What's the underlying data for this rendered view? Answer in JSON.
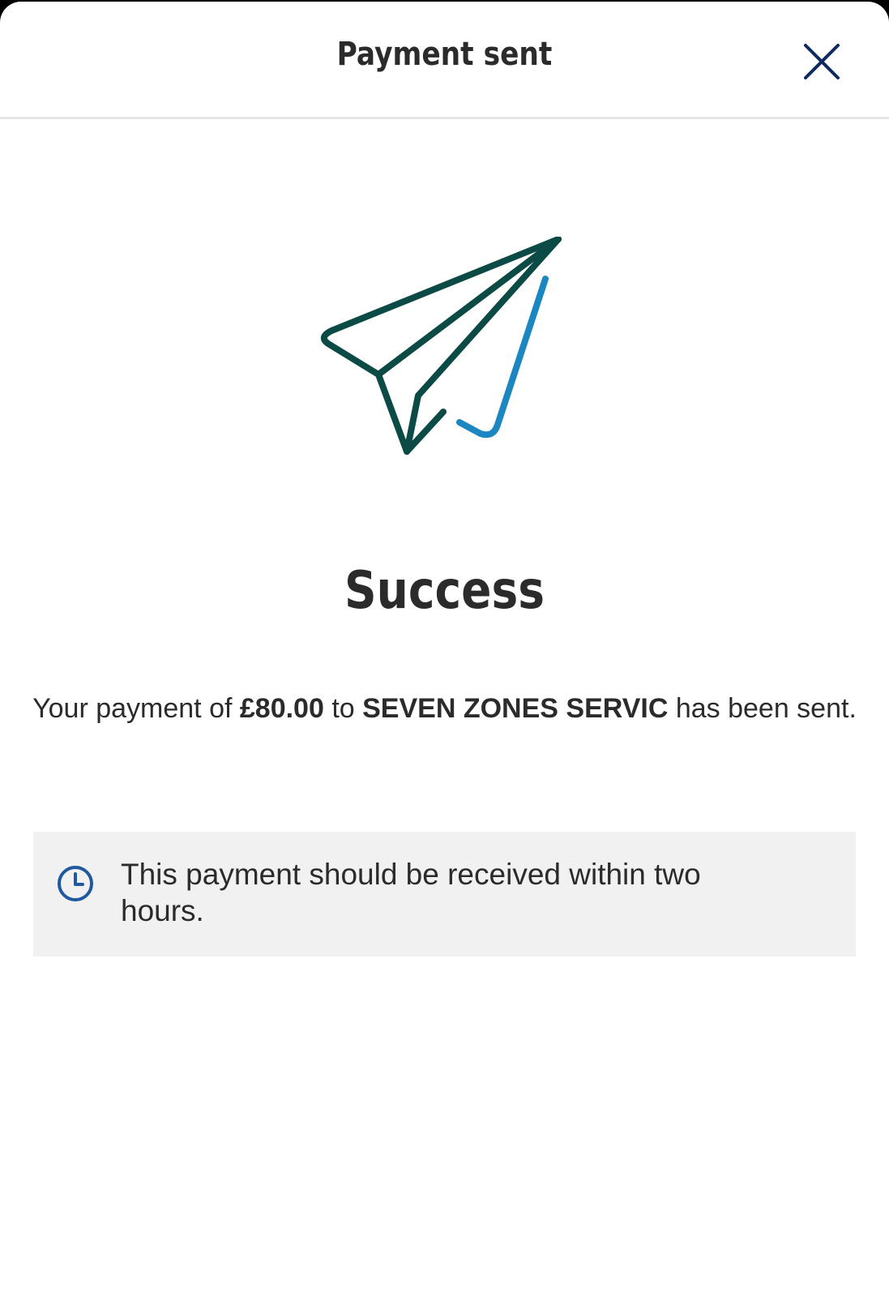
{
  "header": {
    "title": "Payment sent",
    "close_icon": "close-icon"
  },
  "illustration": {
    "icon": "paper-plane-icon",
    "colors": {
      "plane": "#0c4a45",
      "trail": "#1b86c0"
    }
  },
  "main": {
    "title": "Success",
    "message": {
      "prefix": "Your payment of ",
      "amount": "£80.00",
      "middle": " to ",
      "payee": "SEVEN ZONES SERVIC",
      "suffix": " has been sent."
    }
  },
  "info": {
    "icon": "clock-icon",
    "text": "This payment should be received within two hours."
  },
  "colors": {
    "text": "#2b2b2b",
    "accent_blue": "#1f5aa0",
    "close_icon": "#0f2a5e",
    "info_bg": "#f1f1f1"
  }
}
